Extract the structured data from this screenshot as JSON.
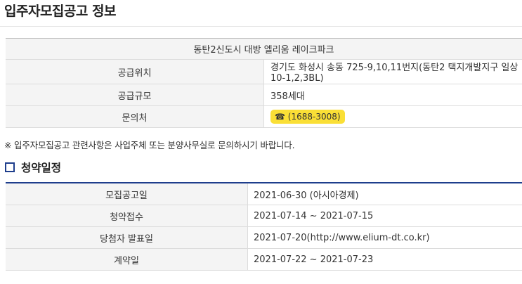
{
  "page": {
    "title": "입주자모집공고 정보"
  },
  "info": {
    "complex_name": "동탄2신도시 대방 엘리움 레이크파크",
    "rows": [
      {
        "label": "공급위치",
        "value": "경기도 화성시 송동 725-9,10,11번지(동탄2 택지개발지구 일상10-1,2,3BL)"
      },
      {
        "label": "공급규모",
        "value": "358세대"
      },
      {
        "label": "문의처",
        "value": "☎ (1688-3008)"
      }
    ]
  },
  "notice": "※ 입주자모집공고 관련사항은 사업주체 또는 분양사무실로 문의하시기 바랍니다.",
  "schedule": {
    "heading": "청약일정",
    "heading_icon": "square-outline-icon",
    "accent_color": "#1e3e8c",
    "rows": [
      {
        "label": "모집공고일",
        "value": "2021-06-30 (아시아경제)"
      },
      {
        "label": "청약접수",
        "value": "2021-07-14 ~ 2021-07-15"
      },
      {
        "label": "당첨자 발표일",
        "value": "2021-07-20(http://www.elium-dt.co.kr)"
      },
      {
        "label": "계약일",
        "value": "2021-07-22 ~ 2021-07-23"
      }
    ]
  },
  "colors": {
    "phone_badge": "#fadf36",
    "label_bg": "#f4f4f4"
  }
}
